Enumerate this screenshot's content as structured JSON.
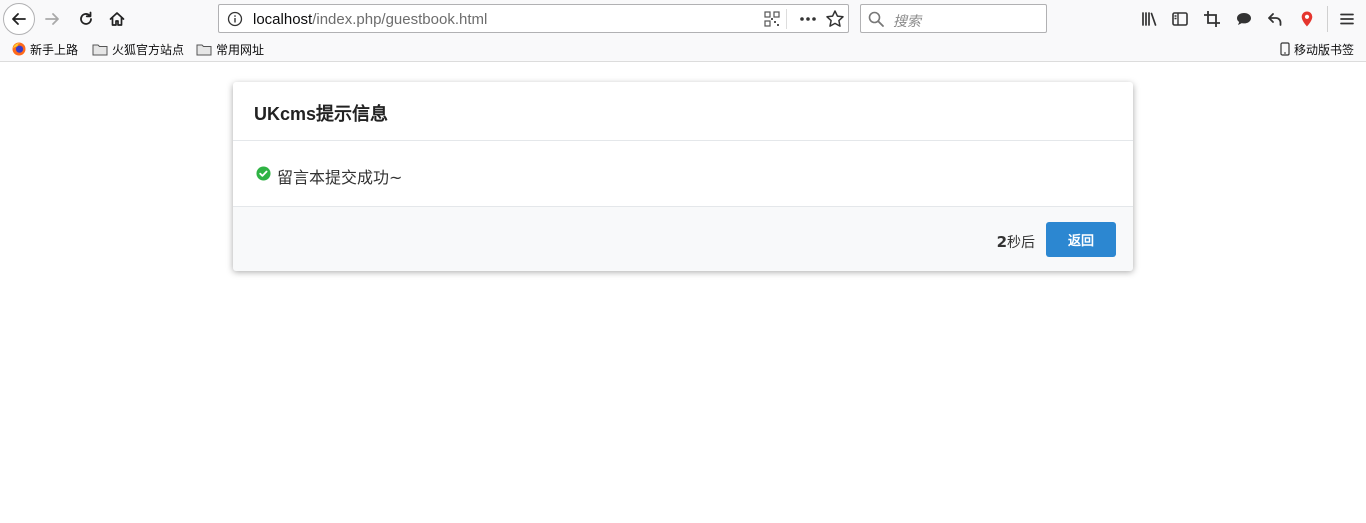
{
  "browser": {
    "url_host": "localhost",
    "url_path": "/index.php/guestbook.html",
    "search_placeholder": "搜索"
  },
  "bookmarks": {
    "items": [
      {
        "label": "新手上路",
        "icon": "firefox-icon"
      },
      {
        "label": "火狐官方站点",
        "icon": "folder-icon"
      },
      {
        "label": "常用网址",
        "icon": "folder-icon"
      }
    ],
    "mobile_label": "移动版书签"
  },
  "dialog": {
    "title": "UKcms提示信息",
    "message": "留言本提交成功~",
    "countdown_number": "2",
    "countdown_suffix": "秒后",
    "back_label": "返回",
    "success_color": "#2fb344",
    "button_color": "#2c87d1"
  }
}
